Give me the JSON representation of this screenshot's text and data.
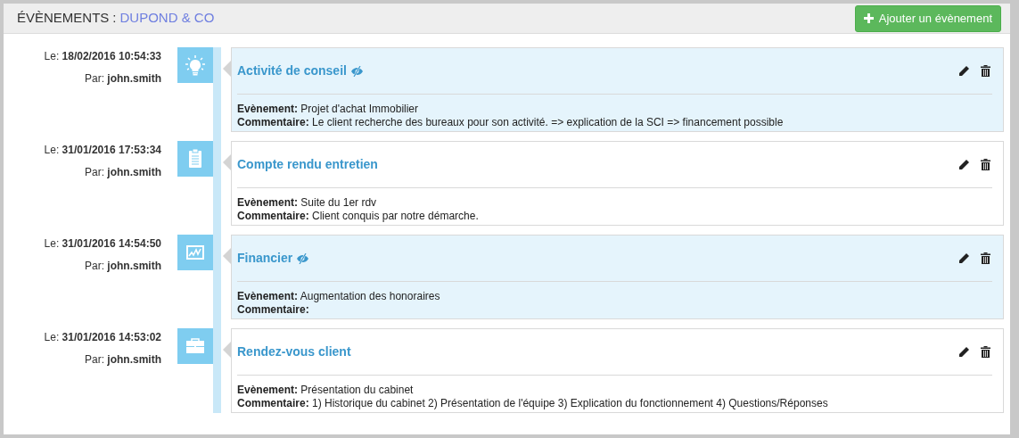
{
  "header": {
    "title": "ÉVÈNEMENTS",
    "separator": ":",
    "client": "DUPOND & CO",
    "add_button": "Ajouter un évènement"
  },
  "events": [
    {
      "date": "Le: **18/02/2016 10:54:33**",
      "author": "Par: **john.smith**",
      "kind": "lightbulb",
      "title": "Activité de conseil",
      "private": true,
      "event": "**Evènement:** Projet d'achat Immobilier",
      "comment": "**Commentaire:** Le client recherche des bureaux pour son activité. => explication de la SCI => financement possible"
    },
    {
      "date": "Le: **31/01/2016 17:53:34**",
      "author": "Par: **john.smith**",
      "kind": "clipboard",
      "title": "Compte rendu entretien",
      "private": false,
      "event": "**Evènement:** Suite du 1er rdv",
      "comment": "**Commentaire:** Client conquis par notre démarche."
    },
    {
      "date": "Le: **31/01/2016 14:54:50**",
      "author": "Par: **john.smith**",
      "kind": "chart",
      "title": "Financier",
      "private": true,
      "event": "**Evènement:** Augmentation des honoraires",
      "comment": "**Commentaire:**"
    },
    {
      "date": "Le: **31/01/2016 14:53:02**",
      "author": "Par: **john.smith**",
      "kind": "briefcase",
      "title": "Rendez-vous client",
      "private": false,
      "event": "**Evènement:** Présentation du cabinet",
      "comment": "**Commentaire:** 1) Historique du cabinet 2) Présentation de l'équipe 3) Explication du fonctionnement 4) Questions/Réponses"
    }
  ]
}
